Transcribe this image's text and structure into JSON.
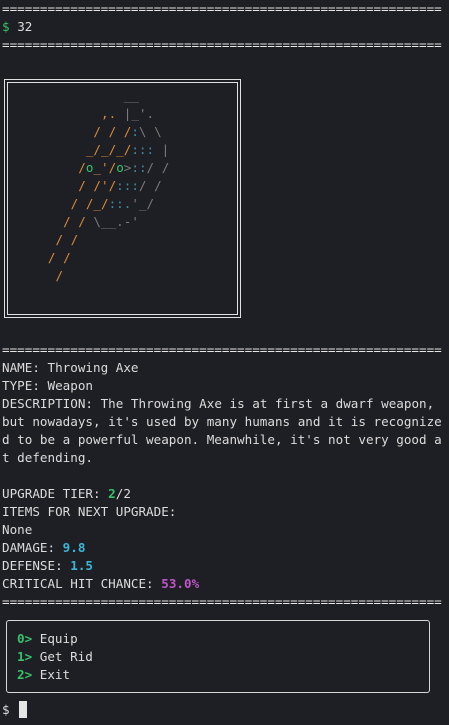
{
  "terminal": {
    "prompt_symbol": "$",
    "command": "32",
    "rule": "=================================================================="
  },
  "item": {
    "name_label": "NAME:",
    "name": "Throwing Axe",
    "type_label": "TYPE:",
    "type": "Weapon",
    "description_label": "DESCRIPTION:",
    "description": "The Throwing Axe is at first a dwarf weapon, but nowadays, it's used by many humans and it is recognized to be a powerful weapon. Meanwhile, it's not very good at defending.",
    "upgrade_tier_label": "UPGRADE TIER:",
    "upgrade_tier_current": "2",
    "upgrade_tier_max": "/2",
    "next_upgrade_label": "ITEMS FOR NEXT UPGRADE:",
    "next_upgrade_items": "None",
    "damage_label": "DAMAGE:",
    "damage": "9.8",
    "defense_label": "DEFENSE:",
    "defense": "1.5",
    "crit_label": "CRITICAL HIT CHANCE:",
    "crit": "53.0%"
  },
  "menu": {
    "items": [
      {
        "key": "0>",
        "label": "Equip"
      },
      {
        "key": "1>",
        "label": "Get Rid"
      },
      {
        "key": "2>",
        "label": "Exit"
      }
    ]
  },
  "colors": {
    "background": "#1e1f24",
    "text": "#dcdcdc",
    "green": "#35c46a",
    "cyan": "#3ab7d6",
    "magenta": "#c254c9",
    "orange": "#d98a3a"
  }
}
